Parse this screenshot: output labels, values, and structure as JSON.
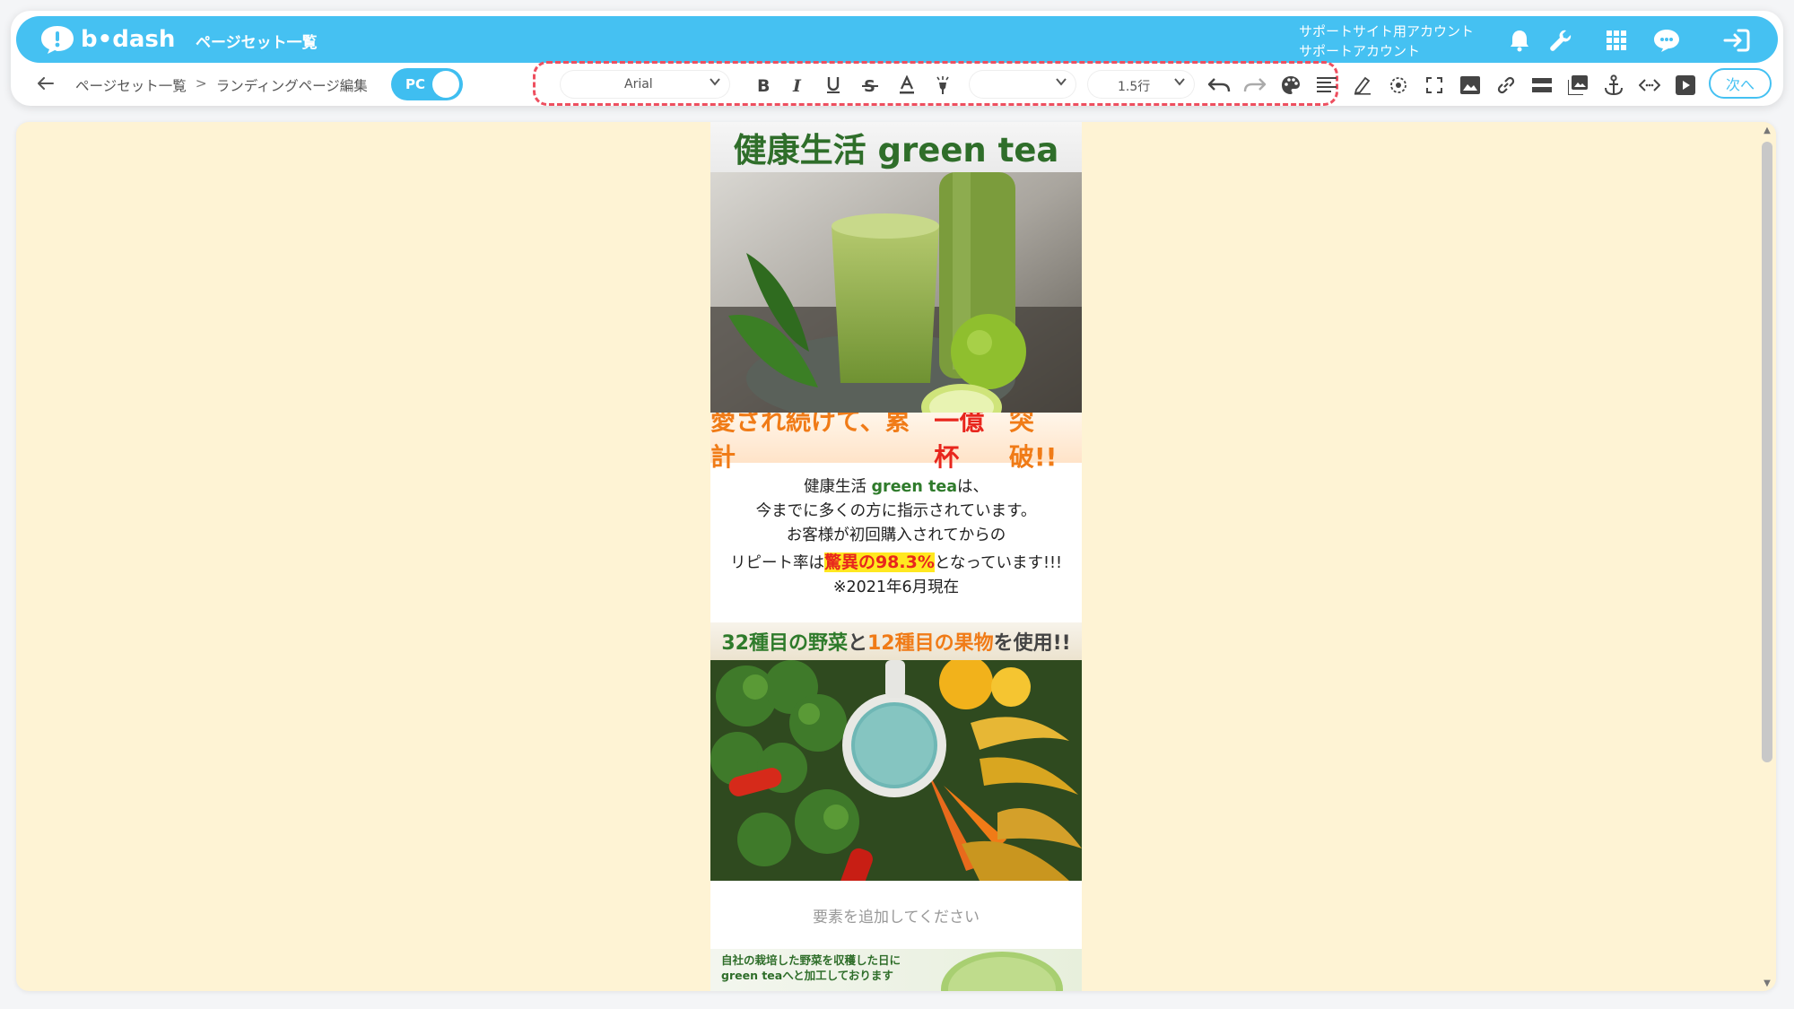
{
  "header": {
    "logo_text": "b•dash",
    "title": "ページセット一覧",
    "account_line1": "サポートサイト用アカウント",
    "account_line2": "サポートアカウント",
    "icons": [
      "bell-icon",
      "wrench-icon",
      "grid-icon",
      "support-icon",
      "logout-icon"
    ]
  },
  "toolbar": {
    "back_icon": "back-arrow-icon",
    "breadcrumb": [
      "ページセット一覧",
      ">",
      "ランディングページ編集"
    ],
    "device_toggle": "PC",
    "font_family": "Arial",
    "font_size": "",
    "line_height": "1.5行",
    "next_label": "次へ",
    "buttons": [
      "bold",
      "italic",
      "underline",
      "strikethrough",
      "font-color",
      "highlight",
      "undo",
      "redo",
      "palette",
      "align",
      "pen",
      "target",
      "fullscreen",
      "image",
      "link",
      "divider",
      "gallery",
      "anchor",
      "code",
      "video"
    ],
    "accent_color": "#45c1f2",
    "dashed_highlight_color": "#ee4f5f"
  },
  "canvas": {
    "background": "#fef3d4",
    "lp": {
      "title": "健康生活 green tea",
      "banner1_a": "愛され続けて、累計",
      "banner1_b": "一億杯",
      "banner1_c": "突破!!",
      "text_l1a": "健康生活 ",
      "text_l1b": "green tea",
      "text_l1c": "は、",
      "text_l2": "今までに多くの方に指示されています。",
      "text_l3": "お客様が初回購入されてからの",
      "text_l4a": "リピート率は",
      "text_l4b": "驚異の98.3%",
      "text_l4c": "となっています!!!",
      "text_l5": "※2021年6月現在",
      "banner2_a": "32種目の野菜",
      "banner2_b": "と",
      "banner2_c": "12種目の果物",
      "banner2_d": "を使用!!",
      "add_element": "要素を追加してください",
      "bottom_l1": "自社の栽培した野菜を収穫した日に",
      "bottom_l2": "green teaへと加工しております"
    }
  }
}
